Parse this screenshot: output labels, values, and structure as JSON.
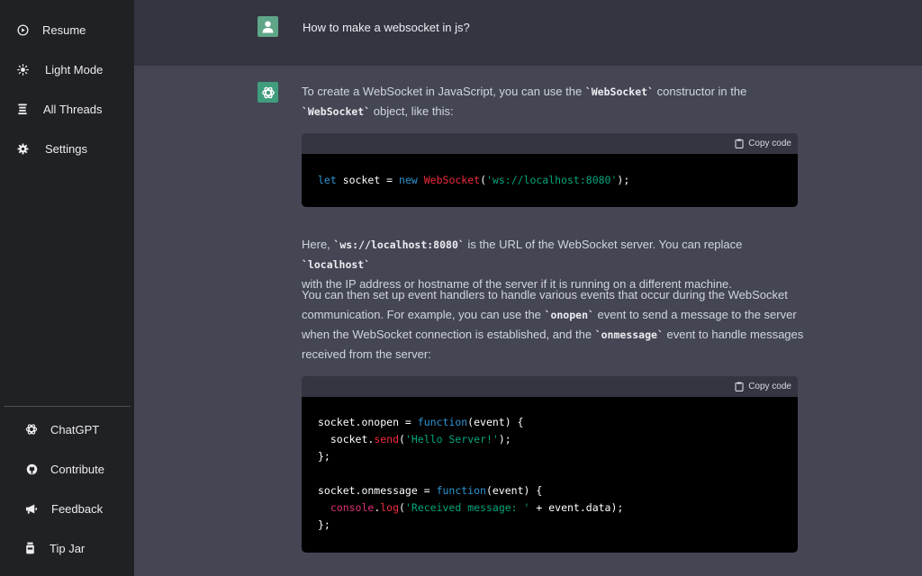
{
  "sidebar": {
    "top_items": [
      {
        "label": "Resume",
        "icon": "play-circle-icon"
      },
      {
        "label": "Light Mode",
        "icon": "sun-icon"
      },
      {
        "label": "All Threads",
        "icon": "threads-list-icon"
      },
      {
        "label": "Settings",
        "icon": "gear-icon"
      }
    ],
    "bottom_items": [
      {
        "label": "ChatGPT",
        "icon": "openai-logo-icon"
      },
      {
        "label": "Contribute",
        "icon": "github-icon"
      },
      {
        "label": "Feedback",
        "icon": "megaphone-icon"
      },
      {
        "label": "Tip Jar",
        "icon": "jar-icon"
      }
    ]
  },
  "conversation": {
    "question": "How to make a websocket in js?",
    "answer": {
      "intro_before": "To create a WebSocket in JavaScript, you can use the ",
      "intro_code1": "`WebSocket`",
      "intro_mid": " constructor in the",
      "intro_code2": "`WebSocket`",
      "intro_after": " object, like this:",
      "copy_label": "Copy code",
      "code1": {
        "let": "let",
        "var": " socket = ",
        "new": "new",
        "ctor": "WebSocket",
        "paren_open": "(",
        "str": "'ws://localhost:8080'",
        "paren_close": ");"
      },
      "p2_before": "Here, ",
      "p2_code1": "`ws://localhost:8080`",
      "p2_mid": " is the URL of the WebSocket server. You can replace ",
      "p2_code2": "`localhost`",
      "p2_after": "with the IP address or hostname of the server if it is running on a different machine.",
      "p3_line1": "You can then set up event handlers to handle various events that occur during the WebSocket",
      "p3_line2_before": "communication. For example, you can use the ",
      "p3_code1": "`onopen`",
      "p3_line2_after": " event to send a message to the server",
      "p3_line3_before": "when the WebSocket connection is established, and the ",
      "p3_code2": "`onmessage`",
      "p3_line3_after": " event to handle messages",
      "p3_line4": "received from the server:",
      "code2": {
        "l1_a": "socket.onopen = ",
        "l1_fn": "function",
        "l1_b": "(event) {",
        "l2_a": "  socket.",
        "l2_send": "send",
        "l2_open": "(",
        "l2_str": "'Hello Server!'",
        "l2_close": ");",
        "l3": "};",
        "l5_a": "socket.onmessage = ",
        "l5_fn": "function",
        "l5_b": "(event) {",
        "l6_console": "  console",
        "l6_dot": ".",
        "l6_log": "log",
        "l6_open": "(",
        "l6_str": "'Received message: '",
        "l6_rest": " + event.data);",
        "l7": "};"
      }
    }
  },
  "colors": {
    "sidebar_bg": "#202123",
    "user_row_bg": "#343541",
    "assistant_bg": "#444654",
    "code_keyword": "#2e95d3",
    "code_function": "#f22c3d",
    "code_string": "#00a67d"
  }
}
